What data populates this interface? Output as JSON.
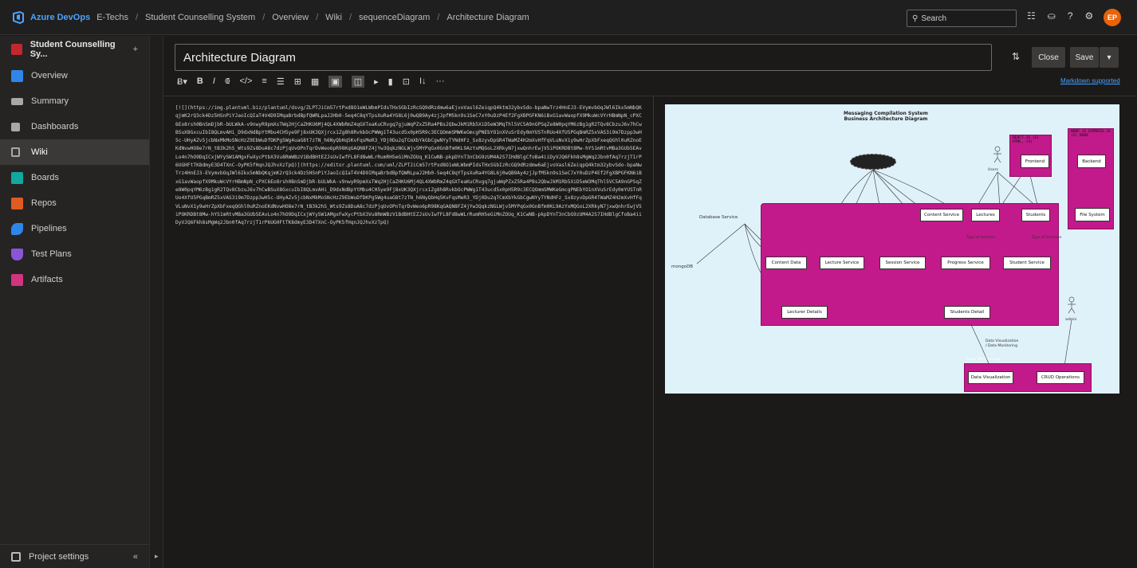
{
  "topbar": {
    "brand": "Azure DevOps",
    "breadcrumbs": [
      "E-Techs",
      "Student Counselling System",
      "Overview",
      "Wiki",
      "sequenceDiagram",
      "Architecture Diagram"
    ],
    "search_placeholder": "Search",
    "icons": [
      "list-icon",
      "bag-icon",
      "help-icon",
      "user-settings-icon"
    ],
    "avatar_initials": "EP"
  },
  "sidebar": {
    "project_name": "Student Counselling Sy...",
    "add_label": "+",
    "items": [
      {
        "label": "Overview",
        "icon": "overview-icon",
        "color": "#2f86e8"
      },
      {
        "label": "Summary",
        "icon": "summary-icon",
        "color": "#a8a8a8"
      },
      {
        "label": "Dashboards",
        "icon": "dashboards-icon",
        "color": "#a8a8a8"
      },
      {
        "label": "Wiki",
        "icon": "wiki-icon",
        "color": "#a8a8a8"
      },
      {
        "label": "Boards",
        "icon": "boards-icon",
        "color": "#13a89e"
      },
      {
        "label": "Repos",
        "icon": "repos-icon",
        "color": "#e05b1f"
      },
      {
        "label": "Pipelines",
        "icon": "pipelines-icon",
        "color": "#2f86e8"
      },
      {
        "label": "Test Plans",
        "icon": "test-plans-icon",
        "color": "#8a55d6"
      },
      {
        "label": "Artifacts",
        "icon": "artifacts-icon",
        "color": "#d1357e"
      }
    ],
    "active_item": "Wiki",
    "settings_label": "Project settings",
    "collapse_label": "«"
  },
  "page": {
    "title": "Architecture Diagram",
    "close_label": "Close",
    "save_label": "Save",
    "save_menu_label": "▾",
    "markdown_link": "Markdown supported"
  },
  "toolbar": {
    "items": [
      "Ƀ▾",
      "B",
      "I",
      "⟃",
      "</>",
      "≡",
      "☰",
      "⊞",
      "▦",
      "▣",
      "◫",
      "▸",
      "▮",
      "⊡",
      "I↓",
      "···"
    ]
  },
  "editor": {
    "content": "[![](https://img.plantuml.biz/plantuml/dsvg/ZLPTJiCm57rtPxd8O1eWLWbmPIdsTHxSGbIzRcGQ9dRzdmw6aEjvoVasl6ZeiqpQ4ktm32ybvSdo-bpaNwTrz4HnEJ3-EVymvbOqJWl6Ikx5mNbQKqjmK2rQ3ck4Dz5HSnPiYJaoIcQIaT4V4D9IMqaBrbdBpfQWRLpaJ2Hb0-5eq4C8qYTpsXuRa4YG8L6j0wQB9Ay4zjJpfM5kn9s1SeC7xY0uDzP4Ef2FgXBPGFKN6iBxG1avWaopfX9MkuWcVYrHBmNpN_cPXC6Eo8rsh0BnSmDjbR-bULWkA-v9nwyR9pmXsTWq2HjCaZHKU6Mj4QL4XWbRmZ4qGXTeaKuCRvgq7gjuWqPZxZ5Ra4PBs2QbwJkM1Rb5XiD5eW3MqThl5VC5A9nGPSqZe8W0pqYM6zBg1gR2TQv8CbzuJ6v7hCwBSuX8GxcuIbI8QLmvAHi_D9dxNdBpYtMbu4CH5ye9Fj8xUK3QXjrcx1Zg8h8RvkbOcPWWg1T43ucd5x0pH5R9c3ECQOmmSMWKeGmcgPNEbYO1nXVuSrEdy0mYUSTnRUo4XfU5PGqBmRZ5xVAS3i9m7Dzpp3wH5c-UHyAZv5jcbNxMkMoSNcHzZ9EbWuDfDKPg5Wg4uaG8t7zTN_h6NyQbHq5KvFqsMeR3_YDj0Du2qTCmXbYkGbCgwNYyTYNdHFz_Sx8zyvDpGR4TWaMZ4H2mXvHfFqVLuNvX1y9wHrZpXbFxeqQGhl0uRZnoEKdNvwHO8e7rN_tB3k2hS_Wts9Zs8DuA8c7dzPjqUvOPnTqrDvWeo6pR98KqGAQN8FZ4jYw3QqkzNGLWjv5MYPqGx0GnBfm0KL9AzYxMQGoL2XRkyN7jxwQnhrEwjV5iPOKRDBt8Mw-hYS1mRtvMBa3GUb5EAvLo4n7hO9DqICxjWYySW1AMgxFwXycPtbX3Vu8RmWBzV1BdBHtEZJsUvIwfFL8Fd8wWLrRumRH5eGiMnZOUq_K1CwNB-pkpDYnT3nCbG9zUM4A2S7IHdBlgCfoBa4iiDyVJQ6Fkh8sMgWq2Jbn0fAq7rzjT1rP6UGHFtTK8dmyE3D4TXnC-OyPK5fHqnJQJhvXzTpQ)](https://editor.plantuml.com/uml/ZLPTJiCm57rtPxd8O1eWLWbmPIdsTHxSGbIzRcGQ9dRzdmw6aEjvoVasl6ZeiqpQ4ktm32ybvSdo-bpaNwTrz4HnEJ3-EVymvbOqJWl6Ikx5mNbQKqjmK2rQ3ck4Dz5HSnPiYJaoIcQIaT4V4D9IMqaBrbdBpfQWRLpaJ2Hb0-5eq4C8qYTpsXuRa4YG8L6j0wQB9Ay4zjJpfM5kn9s1SeC7xY0uDzP4Ef2FgXBPGFKN6iBxG1avWaopfX9MkuWcVYrHBmNpN_cPXC6Eo8rsh0BnSmDjbR-bULWkA-v9nwyR9pmXsTWq2HjCaZHKU6Mj4QL4XWbRmZ4qGXTeaKuCRvgq7gjuWqPZxZ5Ra4PBs2QbwJkM1Rb5XiD5eW3MqThl5VC5A9nGPSqZe8W0pqYM6zBg1gR2TQv8CbzuJ6v7hCwBSuX8GxcuIbI8QLmvAHi_D9dxNdBpYtMbu4CH5ye9Fj8xUK3QXjrcx1Zg8h8RvkbOcPWWg1T43ucd5x0pH5R9c3ECQOmmSMWKeGmcgPNEbYO1nXVuSrEdy0mYUSTnRUo4XfU5PGqBmRZ5xVAS3i9m7Dzpp3wH5c-UHyAZv5jcbNxMkMoSNcHzZ9EbWuDfDKPg5Wg4uaG8t7zTN_h6NyQbHq5KvFqsMeR3_YDj0Du2qTCmXbYkGbCgwNYyTYNdHFz_Sx8zyvDpGR4TWaMZ4H2mXvHfFqVLuNvX1y9wHrZpXbFxeqQGhl0uRZnoEKdNvwHO8e7rN_tB3k2hS_Wts9Zs8DuA8c7dzPjqUvOPnTqrDvWeo6pR98KqGAQN8FZ4jYw3QqkzNGLWjv5MYPqGx0GnBfm0KL9AzYxMQGoL2XRkyN7jxwQnhrEwjV5iPOKRDBt8Mw-hYS1mRtvMBa3GUb5EAvLo4n7hO9DqICxjWYySW1AMgxFwXycPtbX3Vu8RmWBzV1BdBHtEZJsUvIwfFL8Fd8wWLrRumRH5eGiMnZOUq_K1CwNB-pkpDYnT3nCbG9zUM4A2S7IHdBlgCfoBa4iiDyVJQ6Fkh8sMgWq2Jbn0fAq7rzjT1rP6UGHFtTK8dmyE3D4TXnC-OyPK5fHqnJQJhvXzTpQ)"
  },
  "diagram": {
    "title_line1": "Messaging Compilation System",
    "title_line2": "Business Architecture Diagram",
    "packages": {
      "frontend": "REACT.JS (S) HTML, (S)",
      "backend": "NODE.JS EXPRESS.JS (S) NODE",
      "main": "",
      "visualization": "Data Monitoring"
    },
    "components": {
      "frontend": "Frontend",
      "backend": "Backend",
      "file_system": "File System",
      "content_service_top": "Content Service",
      "lectures": "Lectures",
      "students": "Students",
      "content_data": "Content Data",
      "lecture_service": "Lecture Service",
      "session_service": "Session Service",
      "progress_service": "Progress Service",
      "student_service": "Student Service",
      "lecturer_details": "Lecturer Details",
      "students_detail": "Students Detail",
      "data_visualization": "Data Visualization",
      "crud_operations": "CRUD Operations"
    },
    "plain": {
      "database_service": "Database Service",
      "mongodb": "mongoDB",
      "users": "Users",
      "admin": "admin"
    },
    "edge_labels": {
      "type_of_lectures": "Type of lectures",
      "type_of_services": "Type of Services",
      "data_visualization_note": "Data Visualization / Data Monitoring"
    }
  }
}
